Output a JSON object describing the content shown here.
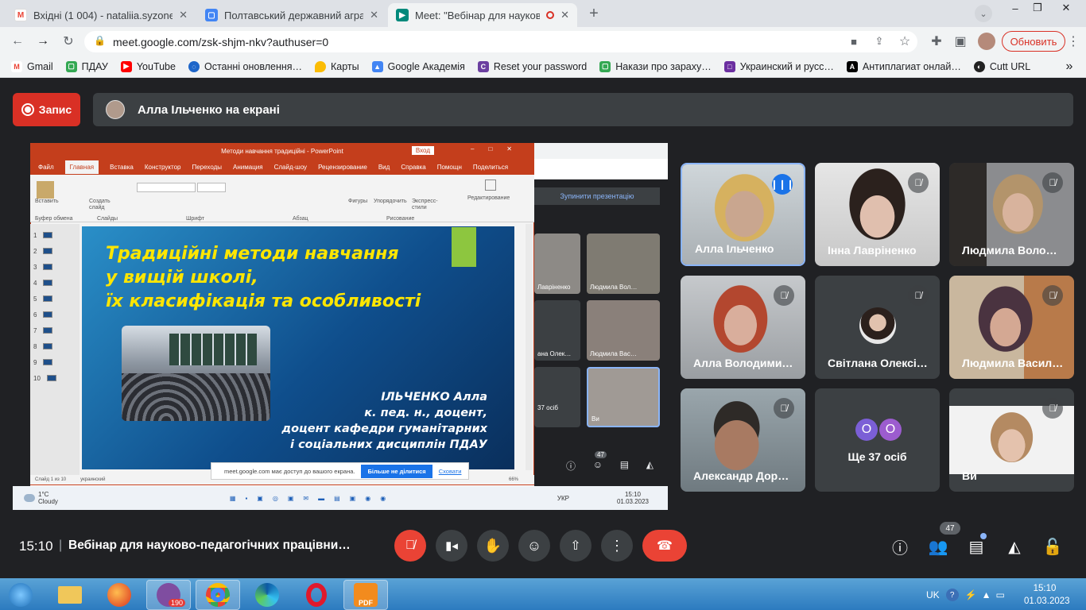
{
  "browser": {
    "tabs": [
      {
        "title": "Вхідні (1 004) - nataliia.syzonenko",
        "icon": "gmail-icon"
      },
      {
        "title": "Полтавський державний аграрн",
        "icon": "google-sites-icon"
      },
      {
        "title": "Meet: \"Вебінар для науково",
        "icon": "meet-icon"
      }
    ],
    "url": "meet.google.com/zsk-shjm-nkv?authuser=0",
    "update_label": "Обновить",
    "bookmarks": [
      "Gmail",
      "ПДАУ",
      "YouTube",
      "Останні оновлення…",
      "Карты",
      "Google Академія",
      "Reset your password",
      "Накази про зараху…",
      "Украинский и русс…",
      "Антиплагиат онлай…",
      "Cutt URL"
    ]
  },
  "meet": {
    "record_label": "Запис",
    "presenting_text": "Алла Ільченко на екрані",
    "time": "15:10",
    "meeting_title": "Вебінар для науково-педагогічних працівни…",
    "participant_count": "47",
    "tiles": [
      {
        "name": "Алла Ільченко",
        "speaking": true
      },
      {
        "name": "Інна Лавріненко",
        "speaking": false
      },
      {
        "name": "Людмила Воло…",
        "speaking": false
      },
      {
        "name": "Алла Володими…",
        "speaking": false
      },
      {
        "name": "Світлана Олексі…",
        "speaking": false
      },
      {
        "name": "Людмила Васил…",
        "speaking": false
      },
      {
        "name": "Александр Дор…",
        "speaking": false
      },
      {
        "name": "Ще 37 осіб",
        "speaking": false
      },
      {
        "name": "Ви",
        "speaking": false
      }
    ],
    "others_avatars": [
      "O",
      "O"
    ],
    "colors": {
      "accent": "#8ab4f8",
      "danger": "#ea4335",
      "tile": "#3c4043",
      "bg": "#202124",
      "others1": "#7b5fd6",
      "others2": "#9c5ccf"
    }
  },
  "screen": {
    "ppt_title": "Методи навчання традиційні - PowerPoint",
    "ppt_signin": "Вход",
    "ppt_tabs": [
      "Файл",
      "Главная",
      "Вставка",
      "Конструктор",
      "Переходы",
      "Анимация",
      "Слайд-шоу",
      "Рецензирование",
      "Вид",
      "Справка",
      "Помощн",
      "Поделиться"
    ],
    "ribbon_groups": [
      "Буфер обмена",
      "Слайды",
      "Шрифт",
      "Абзац",
      "Рисование",
      "Редактирование"
    ],
    "ribbon_buttons": [
      "Вставить",
      "Создать слайд",
      "Фигуры",
      "Упорядочить",
      "Экспресс-стили"
    ],
    "slide_numbers": [
      "1",
      "2",
      "3",
      "4",
      "5",
      "6",
      "7",
      "8",
      "9",
      "10"
    ],
    "slide_title": "Традиційні методи навчання\nу вищій школі,\nїх класифікація та особливості",
    "slide_author": "ІЛЬЧЕНКО Алла\nк. пед. н., доцент,\nдоцент кафедри гуманітарних\nі соціальних дисциплін ПДАУ",
    "status_slide": "Слайд 1 из 10",
    "status_lang": "украинский",
    "zoom": "66%",
    "share_notice": "meet.google.com має доступ до вашого екрана.",
    "share_stop": "Більше не ділитися",
    "share_hide": "Сховати",
    "inner_stop": "Зупинити презентацію",
    "inner_tiles": [
      "Лавріненко",
      "Людмила Вол…",
      "ана Олек…",
      "Людмила Вас…",
      "37 осіб",
      "Ви"
    ],
    "inner_count": "47",
    "weather_temp": "1°C",
    "weather_text": "Cloudy",
    "inner_lang": "УКР",
    "inner_time": "15:10",
    "inner_date": "01.03.2023"
  },
  "taskbar": {
    "lang": "UK",
    "time": "15:10",
    "date": "01.03.2023",
    "viber_badge": "190",
    "apps": [
      "explorer-icon",
      "firefox-icon",
      "viber-icon",
      "chrome-icon",
      "edge-icon",
      "opera-icon",
      "pdf-icon"
    ],
    "pdf_label": "PDF"
  }
}
